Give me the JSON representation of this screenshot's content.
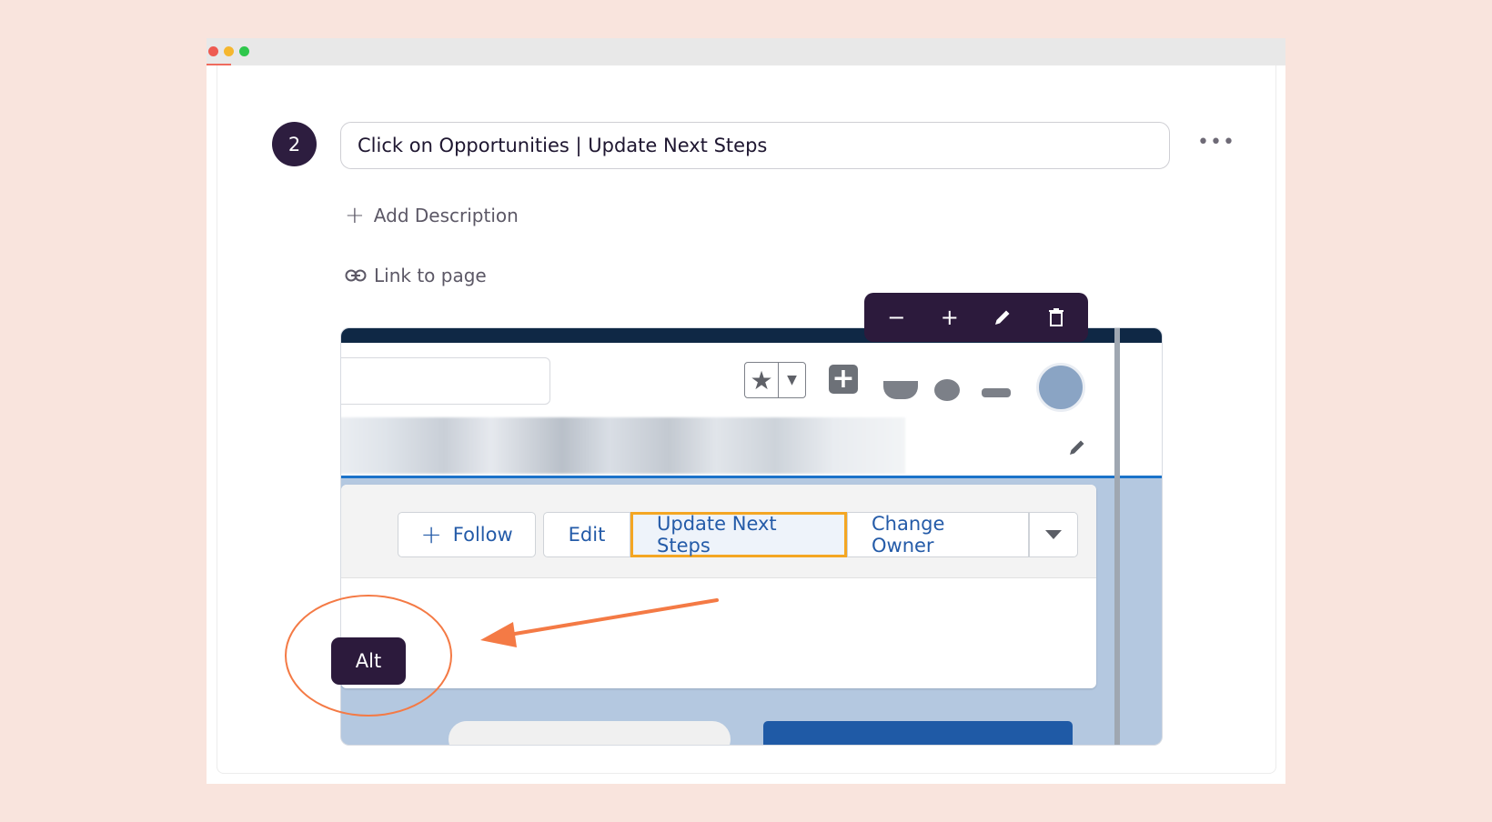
{
  "colors": {
    "background": "#f9e4dd",
    "accent_dark": "#2c1a3c",
    "annotation_orange": "#f47a45",
    "highlight_orange": "#f4a623",
    "salesforce_blue": "#245ba8"
  },
  "window": {
    "controls": [
      "close-dot",
      "minimize-dot",
      "maximize-dot"
    ]
  },
  "step": {
    "number": "2",
    "title": "Click on Opportunities | Update Next Steps",
    "more_icon": "ellipsis-icon",
    "add_description_label": "Add Description",
    "link_to_page_label": "Link to page"
  },
  "screenshot": {
    "header_icons": [
      "favorites-star-icon",
      "global-add-icon",
      "help-icon",
      "setup-gear-icon",
      "notifications-bell-icon",
      "user-avatar-icon"
    ],
    "buttons": {
      "follow": "Follow",
      "edit": "Edit",
      "update_next_steps": "Update Next Steps",
      "change_owner": "Change Owner"
    }
  },
  "image_toolbar": {
    "zoom_out": "−",
    "zoom_in": "+",
    "icons": [
      "zoom-out-icon",
      "zoom-in-icon",
      "pencil-icon",
      "trash-icon"
    ]
  },
  "annotation": {
    "key_badge": "Alt"
  }
}
